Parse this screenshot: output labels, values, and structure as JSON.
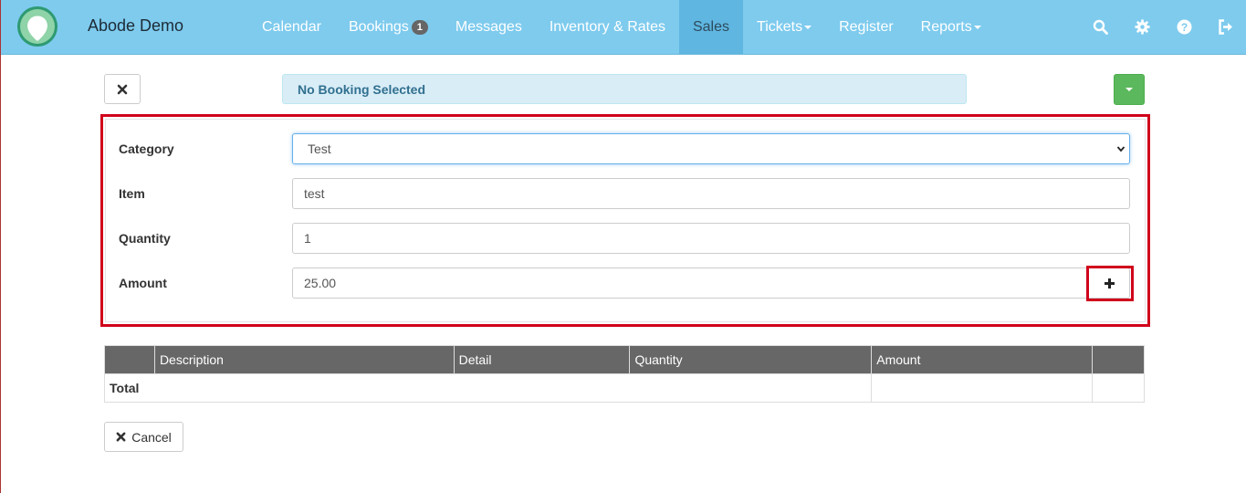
{
  "app": {
    "brand": "Abode Demo"
  },
  "nav": {
    "items": [
      {
        "label": "Calendar"
      },
      {
        "label": "Bookings",
        "badge": "1"
      },
      {
        "label": "Messages"
      },
      {
        "label": "Inventory & Rates"
      },
      {
        "label": "Sales",
        "active": true
      },
      {
        "label": "Tickets",
        "dropdown": true
      },
      {
        "label": "Register"
      },
      {
        "label": "Reports",
        "dropdown": true
      }
    ],
    "icons": [
      "search-icon",
      "gear-icon",
      "help-icon",
      "logout-icon"
    ]
  },
  "booking": {
    "status": "No Booking Selected"
  },
  "form": {
    "category_label": "Category",
    "category_value": "Test",
    "item_label": "Item",
    "item_value": "test",
    "quantity_label": "Quantity",
    "quantity_value": "1",
    "amount_label": "Amount",
    "amount_value": "25.00"
  },
  "table": {
    "headers": [
      "",
      "Description",
      "Detail",
      "Quantity",
      "Amount",
      ""
    ],
    "total_label": "Total"
  },
  "actions": {
    "cancel_label": "Cancel"
  },
  "colors": {
    "navbar": "#7ecbee",
    "active_tab": "#5fb6e0",
    "highlight": "#d0021b",
    "success": "#5cb85c"
  }
}
